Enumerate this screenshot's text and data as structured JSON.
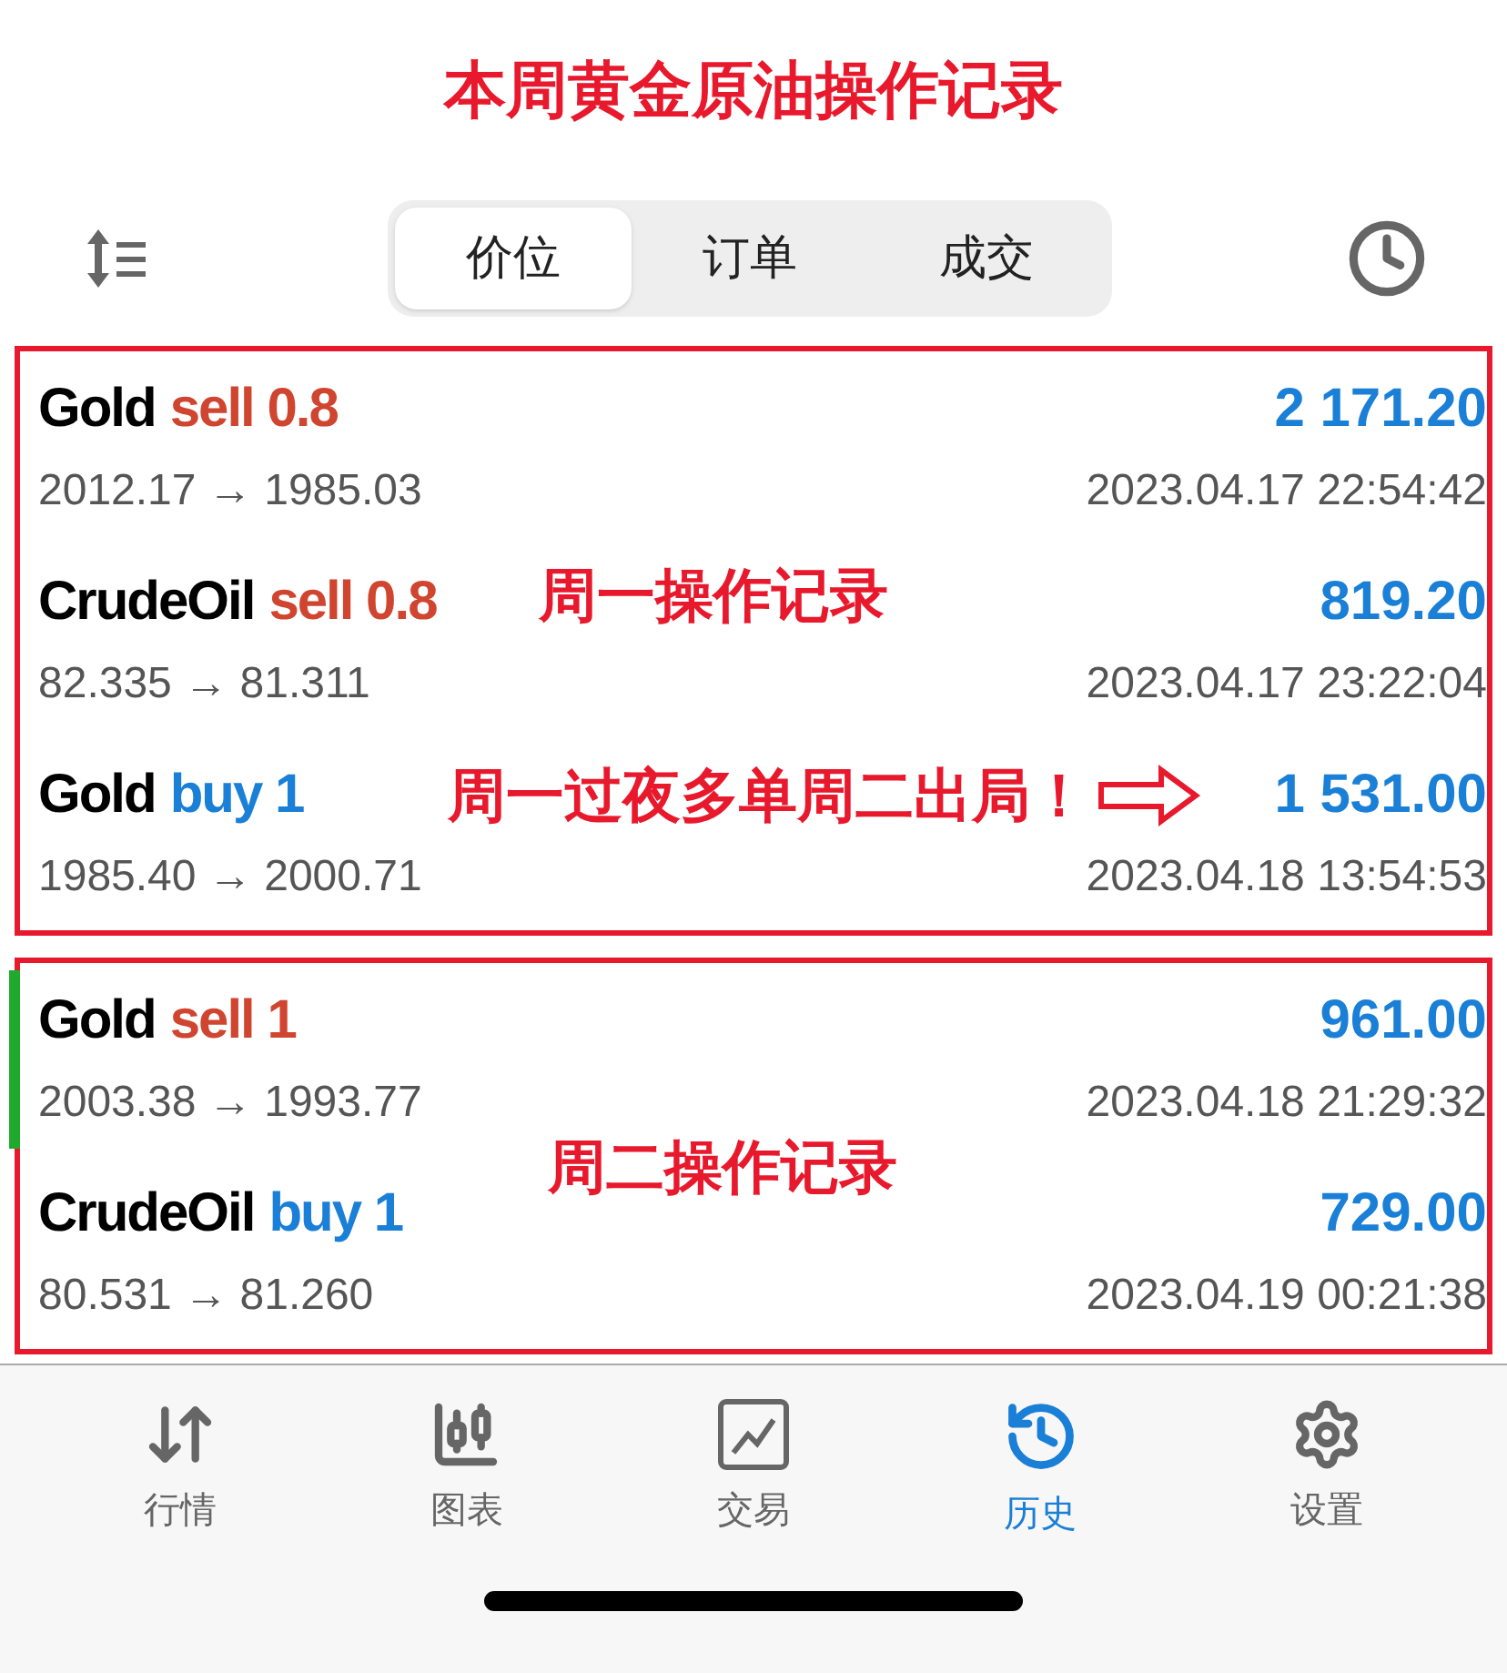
{
  "heading": "本周黄金原油操作记录",
  "segments": [
    {
      "label": "价位",
      "selected": true
    },
    {
      "label": "订单",
      "selected": false
    },
    {
      "label": "成交",
      "selected": false
    }
  ],
  "groups": [
    {
      "notes": [
        {
          "text": "周一操作记录",
          "kind": "plain"
        },
        {
          "text": "周一过夜多单周二出局！",
          "kind": "arrow"
        }
      ],
      "trades": [
        {
          "symbol": "Gold",
          "kind": "sell",
          "action": "sell 0.8",
          "profit": "2 171.20",
          "prices": "2012.17 → 1985.03",
          "time": "2023.04.17 22:54:42",
          "highlighted": false
        },
        {
          "symbol": "CrudeOil",
          "kind": "sell",
          "action": "sell 0.8",
          "profit": "819.20",
          "prices": "82.335 → 81.311",
          "time": "2023.04.17 23:22:04",
          "highlighted": false
        },
        {
          "symbol": "Gold",
          "kind": "buy",
          "action": "buy 1",
          "profit": "1 531.00",
          "prices": "1985.40 → 2000.71",
          "time": "2023.04.18 13:54:53",
          "highlighted": false
        }
      ]
    },
    {
      "notes": [
        {
          "text": "周二操作记录",
          "kind": "plain"
        }
      ],
      "trades": [
        {
          "symbol": "Gold",
          "kind": "sell",
          "action": "sell 1",
          "profit": "961.00",
          "prices": "2003.38 → 1993.77",
          "time": "2023.04.18 21:29:32",
          "highlighted": true
        },
        {
          "symbol": "CrudeOil",
          "kind": "buy",
          "action": "buy 1",
          "profit": "729.00",
          "prices": "80.531 → 81.260",
          "time": "2023.04.19 00:21:38",
          "highlighted": false
        }
      ]
    }
  ],
  "nav": [
    {
      "label": "行情",
      "kind": "quotes",
      "selected": false
    },
    {
      "label": "图表",
      "kind": "chart",
      "selected": false
    },
    {
      "label": "交易",
      "kind": "trade",
      "selected": false
    },
    {
      "label": "历史",
      "kind": "history",
      "selected": true
    },
    {
      "label": "设置",
      "kind": "settings",
      "selected": false
    }
  ]
}
